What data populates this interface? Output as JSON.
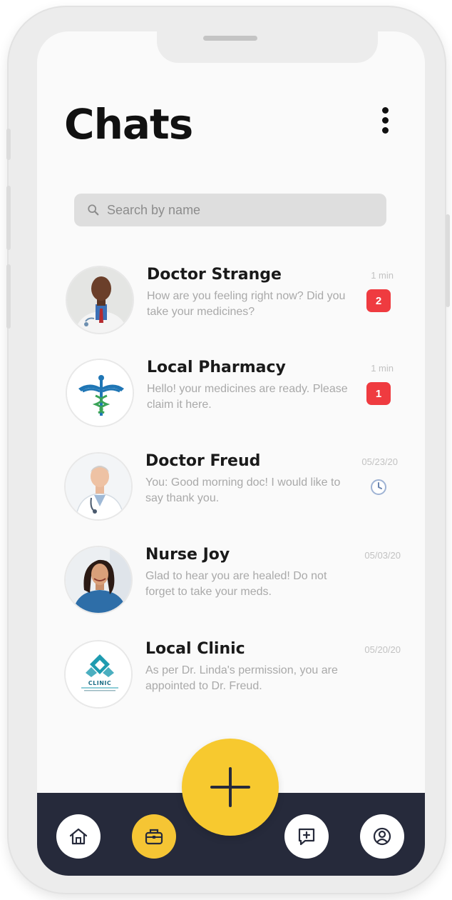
{
  "header": {
    "title": "Chats",
    "menu_icon": "more-vertical-icon"
  },
  "search": {
    "placeholder": "Search by name",
    "icon": "search-icon"
  },
  "colors": {
    "accent": "#f7c92f",
    "badge": "#ef3b40",
    "navbar": "#262a3b",
    "muted_text": "#a9a9a9"
  },
  "chats": [
    {
      "name": "Doctor Strange",
      "message": "How are you feeling right now? Did you take your medicines?",
      "time": "1 min",
      "unread": "2",
      "avatar": "doctor-avatar"
    },
    {
      "name": "Local Pharmacy",
      "message": "Hello! your medicines are ready. Please claim it here.",
      "time": "1 min",
      "unread": "1",
      "avatar": "pharmacy-caduceus-logo"
    },
    {
      "name": "Doctor Freud",
      "message": "You: Good morning doc! I would like to say thank you.",
      "time": "05/23/20",
      "status_icon": "clock-icon",
      "avatar": "doctor-avatar"
    },
    {
      "name": "Nurse Joy",
      "message": "Glad to hear you are healed! Do not forget to take your meds.",
      "time": "05/03/20",
      "avatar": "nurse-avatar"
    },
    {
      "name": "Local Clinic",
      "message": "As per Dr. Linda's permission, you are appointed to Dr. Freud.",
      "time": "05/20/20",
      "avatar": "clinic-logo",
      "logo_text": "CLINIC"
    }
  ],
  "navbar": {
    "items": [
      {
        "icon": "home-icon",
        "active": false
      },
      {
        "icon": "medical-bag-icon",
        "active": true
      },
      {
        "icon": "add-message-icon",
        "active": false
      },
      {
        "icon": "profile-icon",
        "active": false
      }
    ],
    "fab_icon": "plus-icon"
  }
}
